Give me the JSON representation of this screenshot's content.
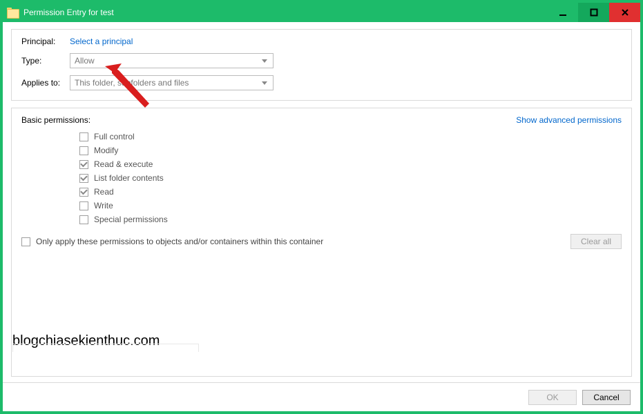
{
  "window": {
    "title": "Permission Entry for test"
  },
  "form": {
    "principal_label": "Principal:",
    "principal_link": "Select a principal",
    "type_label": "Type:",
    "type_value": "Allow",
    "applies_label": "Applies to:",
    "applies_value": "This folder, subfolders and files"
  },
  "permissions": {
    "heading": "Basic permissions:",
    "advanced_link": "Show advanced permissions",
    "items": [
      {
        "label": "Full control",
        "checked": false
      },
      {
        "label": "Modify",
        "checked": false
      },
      {
        "label": "Read & execute",
        "checked": true
      },
      {
        "label": "List folder contents",
        "checked": true
      },
      {
        "label": "Read",
        "checked": true
      },
      {
        "label": "Write",
        "checked": false
      },
      {
        "label": "Special permissions",
        "checked": false
      }
    ],
    "only_apply_label": "Only apply these permissions to objects and/or containers within this container",
    "clear_all": "Clear all"
  },
  "footer": {
    "ok": "OK",
    "cancel": "Cancel"
  },
  "watermark": "blogchiasekienthuc.com"
}
